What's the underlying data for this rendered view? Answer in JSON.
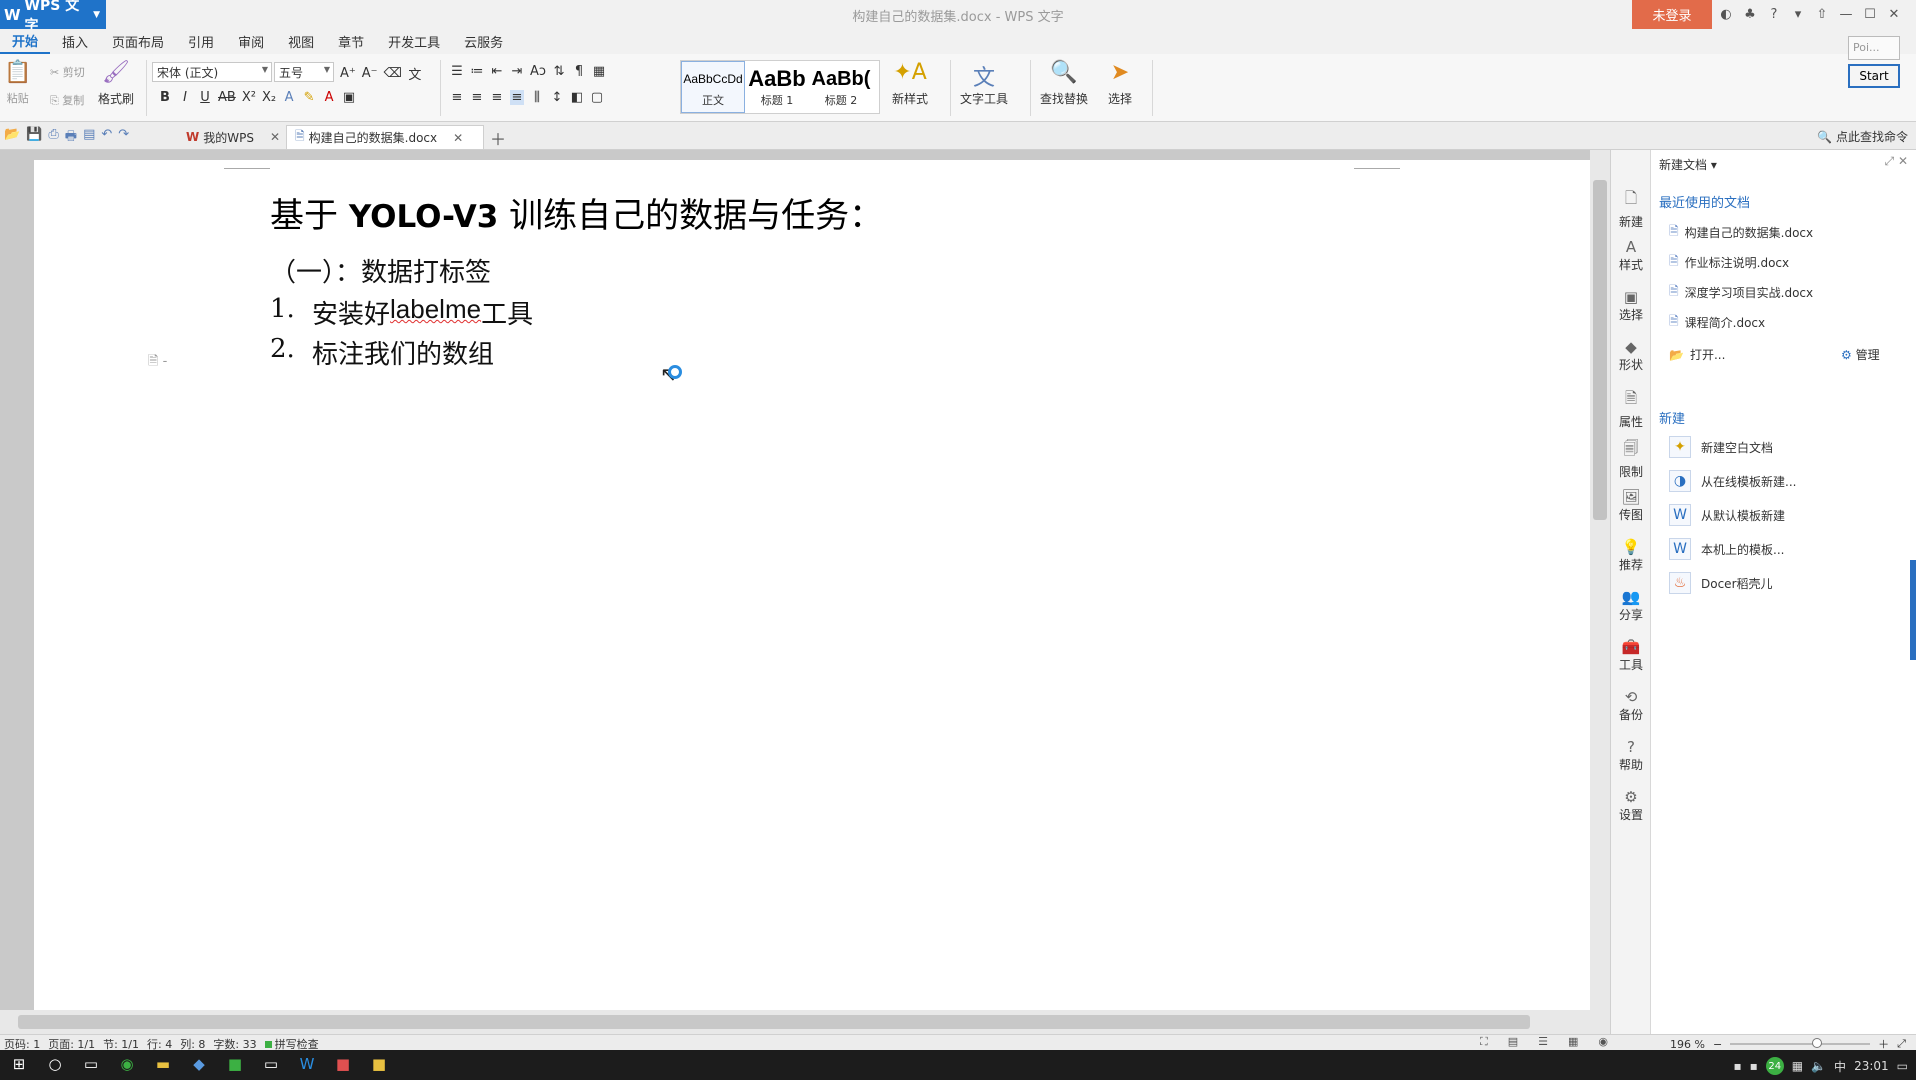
{
  "app": {
    "name": "WPS 文字",
    "doc_title": "构建自己的数据集.docx - WPS 文字",
    "login": "未登录"
  },
  "menu_tabs": [
    "开始",
    "插入",
    "页面布局",
    "引用",
    "审阅",
    "视图",
    "章节",
    "开发工具",
    "云服务"
  ],
  "ribbon": {
    "paste": "粘贴",
    "cut": "剪切",
    "copy": "复制",
    "format_painter": "格式刷",
    "font_name": "宋体 (正文)",
    "font_size": "五号",
    "styles": [
      {
        "sample": "AaBbCcDd",
        "name": "正文"
      },
      {
        "sample": "AaBb",
        "name": "标题 1"
      },
      {
        "sample": "AaBb(",
        "name": "标题 2"
      }
    ],
    "new_style": "新样式",
    "text_tools": "文字工具",
    "find_replace": "查找替换",
    "select": "选择"
  },
  "quickbar": {
    "tabs": [
      {
        "label": "我的WPS"
      },
      {
        "label": "构建自己的数据集.docx"
      }
    ],
    "command_search": "点此查找命令"
  },
  "document": {
    "title_prefix": "基于 ",
    "title_bold": "YOLO-V3",
    "title_suffix": " 训练自己的数据与任务：",
    "section": "（一）：数据打标签",
    "items": [
      {
        "num": "1.",
        "pre": "安装好 ",
        "underlined": "labelme",
        "post": " 工具"
      },
      {
        "num": "2.",
        "pre": "标注我们的数组",
        "underlined": "",
        "post": ""
      }
    ]
  },
  "sidebar": [
    "新建",
    "样式",
    "选择",
    "形状",
    "属性",
    "限制",
    "传图",
    "推荐",
    "分享",
    "工具",
    "备份",
    "帮助",
    "设置"
  ],
  "taskpane": {
    "title": "新建文档",
    "recent_header": "最近使用的文档",
    "recent_files": [
      "构建自己的数据集.docx",
      "作业标注说明.docx",
      "深度学习项目实战.docx",
      "课程简介.docx"
    ],
    "open": "打开...",
    "manage": "管理",
    "new_header": "新建",
    "new_items": [
      "新建空白文档",
      "从在线模板新建...",
      "从默认模板新建",
      "本机上的模板...",
      "Docer稻壳儿"
    ]
  },
  "float": {
    "input": "Poi...",
    "start": "Start"
  },
  "statusbar": {
    "page": "页码: 1",
    "pages": "页面: 1/1",
    "section": "节: 1/1",
    "line": "行: 4",
    "col": "列: 8",
    "words": "字数: 33",
    "spell": "拼写检查",
    "zoom": "196 %"
  },
  "taskbar": {
    "time": "23:01",
    "badge": "24",
    "ime": "中"
  }
}
